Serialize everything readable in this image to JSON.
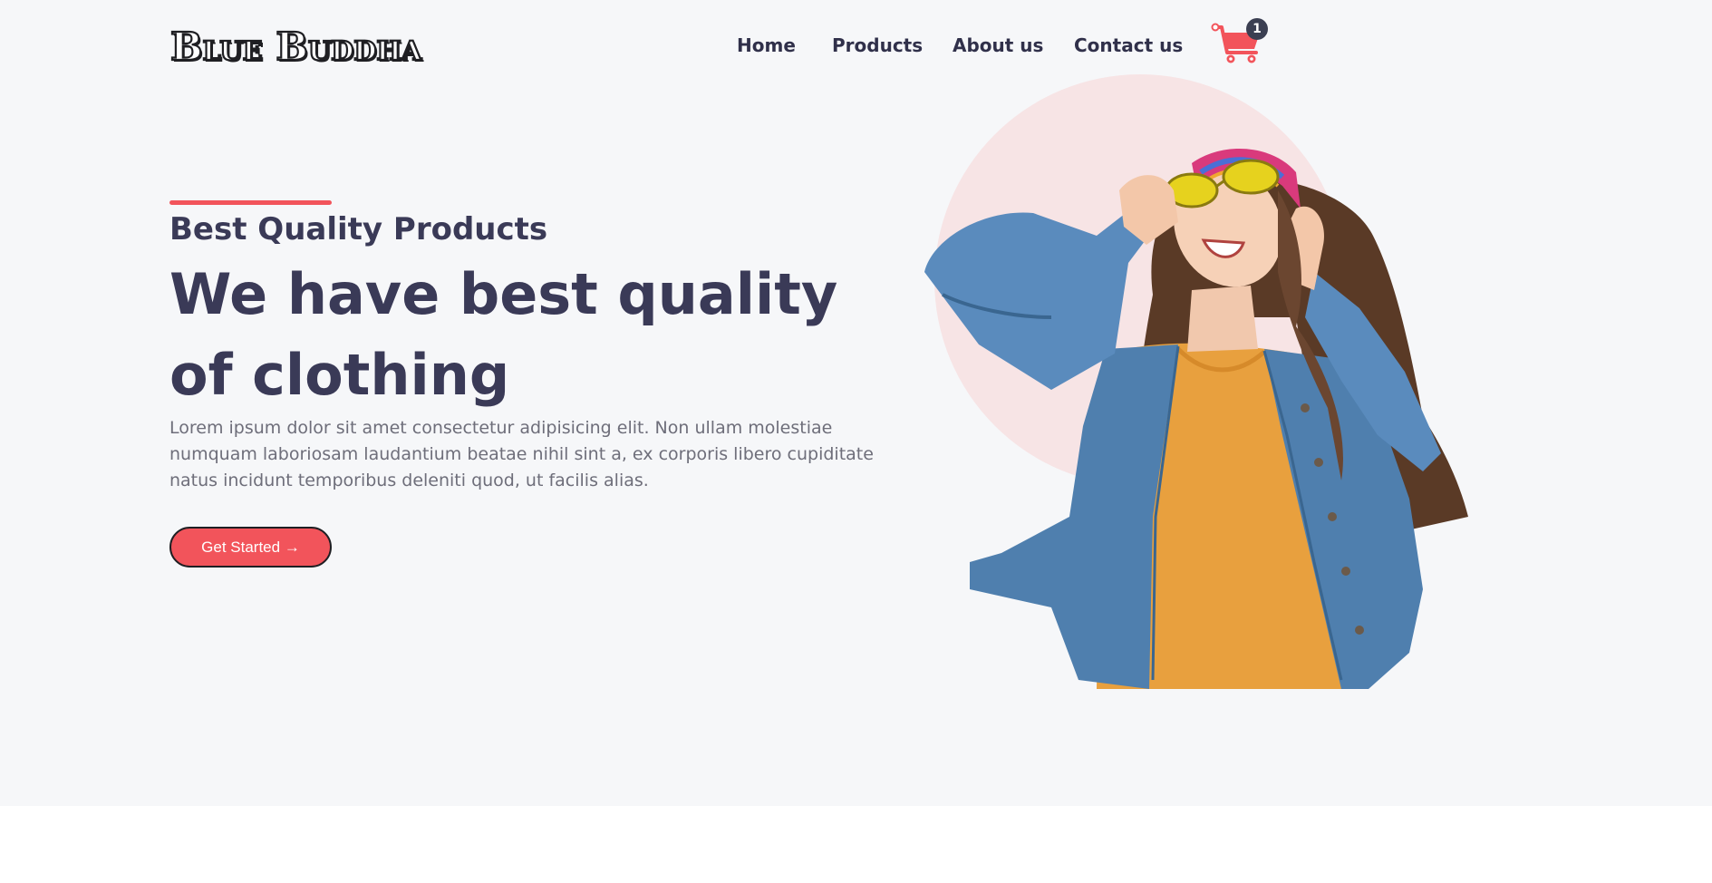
{
  "header": {
    "logo_text": "Blue Buddha",
    "nav": [
      "Home",
      "Products",
      "About us",
      "Contact us"
    ],
    "cart_count": "1",
    "cart_icon": "shopping-cart-icon"
  },
  "hero": {
    "subtitle": "Best Quality Products",
    "headline": "We have best quality of clothing",
    "body": "Lorem ipsum dolor sit amet consectetur adipisicing elit. Non ullam molestiae numquam laboriosam laudantium beatae nihil sint a, ex corporis libero cupiditate natus incidunt temporibus deleniti quod, ut facilis alias.",
    "cta_label": "Get Started →",
    "image": "model-photo-denim-jacket"
  },
  "colors": {
    "accent": "#f2545b",
    "heading": "#3a3a57",
    "body_text": "#6e6e7a",
    "hero_bg": "#f6f7f9",
    "circle": "#f7e4e5",
    "badge": "#3b3f52"
  }
}
